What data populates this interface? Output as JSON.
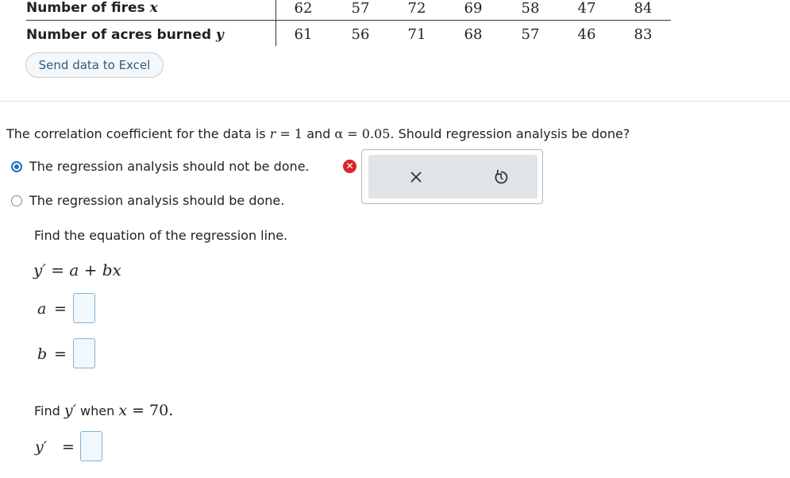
{
  "table": {
    "row1": {
      "label": "Number of fires",
      "var": "x",
      "values": [
        "62",
        "57",
        "72",
        "69",
        "58",
        "47",
        "84"
      ]
    },
    "row2": {
      "label": "Number of acres burned",
      "var": "y",
      "values": [
        "61",
        "56",
        "71",
        "68",
        "57",
        "46",
        "83"
      ]
    }
  },
  "excel_button": "Send data to Excel",
  "question": {
    "p1": "The correlation coefficient for the data is ",
    "r_sym": "r",
    "eq1": " = 1",
    "and": " and ",
    "alpha": "α",
    "eq2": " = 0.05",
    "p2": ". Should regression analysis be done?"
  },
  "options": [
    {
      "label": "The regression analysis should not be done.",
      "selected": true
    },
    {
      "label": "The regression analysis should be done.",
      "selected": false
    }
  ],
  "feedback_popup": {
    "close_glyph": "✕",
    "retry_glyph": "↻"
  },
  "regression": {
    "prompt": "Find the equation of the regression line.",
    "formula_lhs": "y′",
    "formula_rhs": "= a + bx",
    "a_label": "a",
    "b_label": "b",
    "equals": "=",
    "a_value": "",
    "b_value": ""
  },
  "predict": {
    "prompt_find": "Find ",
    "prompt_y": "y′",
    "prompt_when": " when ",
    "prompt_x": "x",
    "prompt_eq": " = 70.",
    "y_label": "y′",
    "y_value": ""
  }
}
